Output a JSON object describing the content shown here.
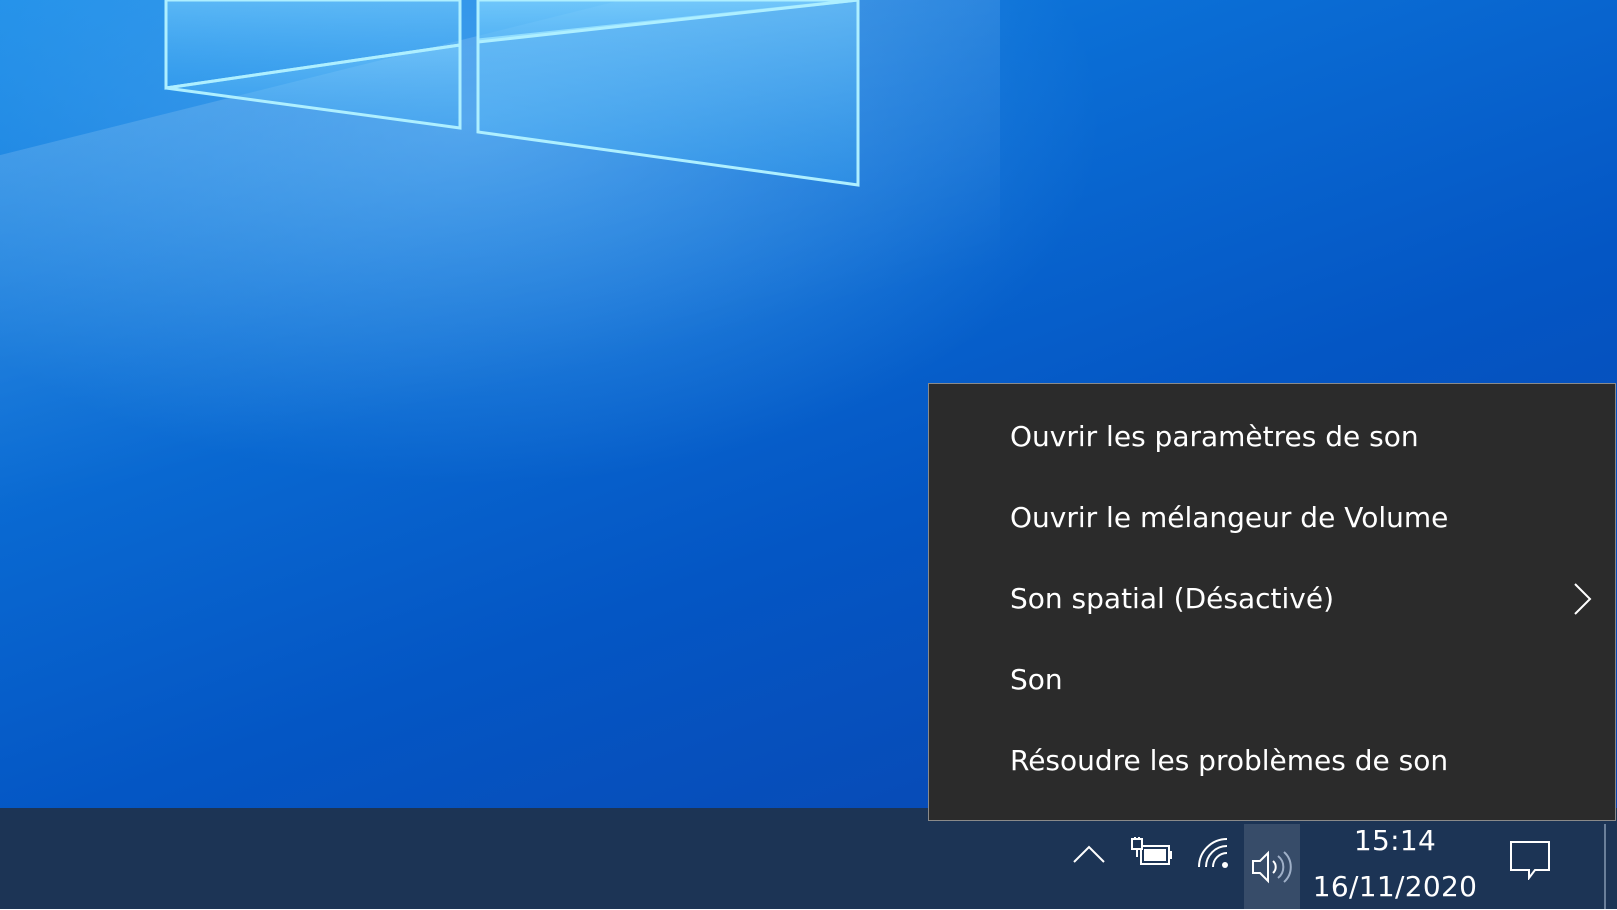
{
  "context_menu": {
    "items": [
      {
        "label": "Ouvrir les paramètres de son",
        "submenu": false
      },
      {
        "label": "Ouvrir le mélangeur de Volume",
        "submenu": false
      },
      {
        "label": "Son spatial (Désactivé)",
        "submenu": true
      },
      {
        "label": "Son",
        "submenu": false
      },
      {
        "label": "Résoudre les problèmes de son",
        "submenu": false
      }
    ]
  },
  "taskbar": {
    "time": "15:14",
    "date": "16/11/2020",
    "icons": [
      "chevron-up-icon",
      "battery-charging-icon",
      "wifi-icon",
      "speaker-icon",
      "notifications-icon"
    ]
  },
  "colors": {
    "menu_bg": "#2b2b2b",
    "taskbar_bg": "#1c3455",
    "desktop_accent": "#0b6fd6"
  }
}
